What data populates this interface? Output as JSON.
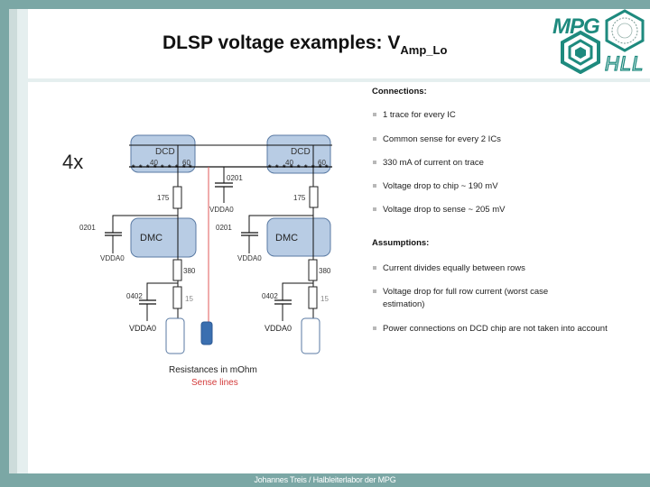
{
  "slide": {
    "title_main": "DLSP voltage examples: V",
    "title_subscript": "Amp_Lo",
    "footer": "Johannes Treis / Halbleiterlabor der MPG",
    "logo": {
      "top_text": "MPG",
      "bottom_text": "HLL"
    }
  },
  "connections": {
    "heading": "Connections:",
    "items": [
      "1 trace for every  IC",
      "Common sense for every 2 ICs",
      "330 mA of current on trace",
      "Voltage drop to chip ~ 190 mV",
      "Voltage drop to sense ~ 205 mV"
    ]
  },
  "assumptions": {
    "heading": "Assumptions:",
    "items": [
      "Current divides equally between rows",
      "Voltage drop for full row current (worst case estimation)",
      "Power connections on DCD chip are not taken into account"
    ]
  },
  "diagram": {
    "multiplier": "4x",
    "dcd_label": "DCD",
    "dmc_label": "DMC",
    "pin_label_left": "40",
    "pin_label_right": "60",
    "r_top": "175",
    "r_mid": "380",
    "r_low": "15",
    "cap_0201": "0201",
    "cap_0402": "0402",
    "vdda": "VDDA0",
    "legend_resistance": "Resistances in mOhm",
    "legend_sense": "Sense lines"
  },
  "colors": {
    "frame_teal": "#7ba7a5",
    "logo_teal": "#1e8a7e",
    "chip_fill": "#b8cce4",
    "chip_stroke": "#5a7aa3",
    "sense_line": "#e05a5a",
    "sense_chip": "#3b6fb0"
  }
}
